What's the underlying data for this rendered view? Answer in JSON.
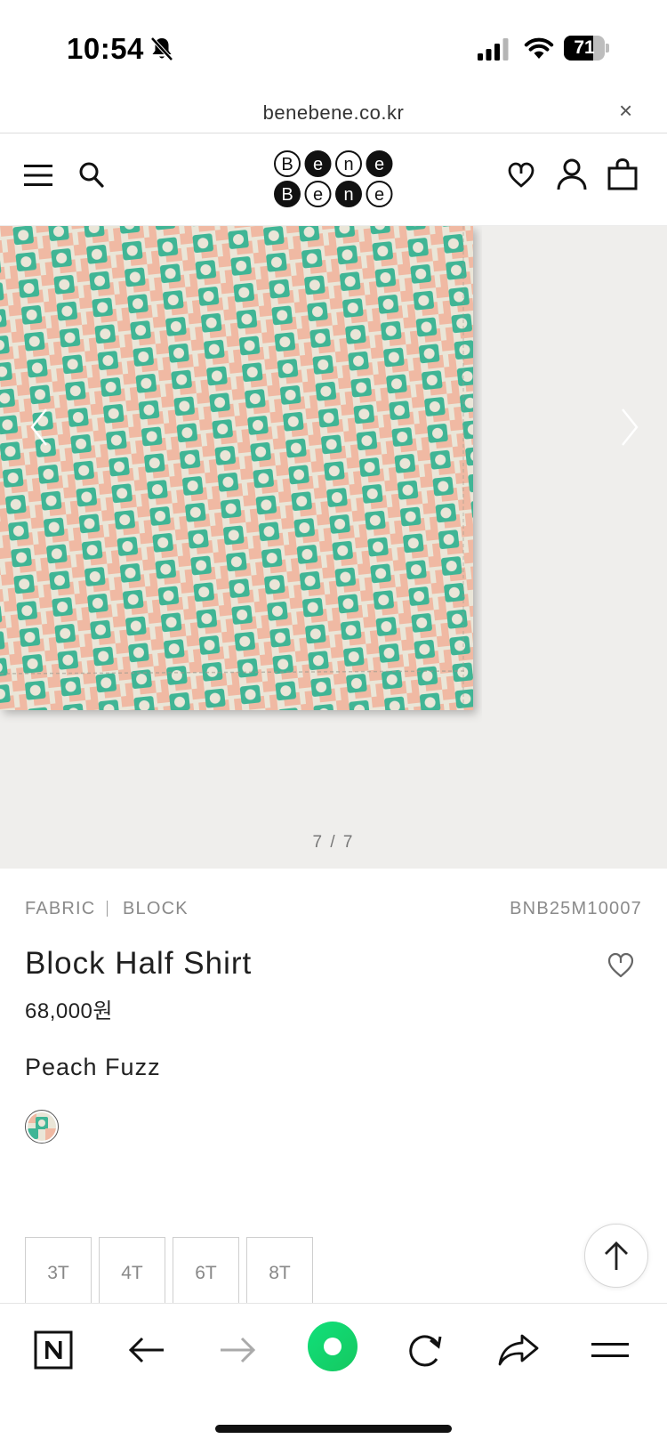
{
  "status_bar": {
    "time": "10:54",
    "battery": "71",
    "battery_level": 0.71
  },
  "url_bar": {
    "domain": "benebene.co.kr",
    "close_label": "×"
  },
  "header": {
    "logo_letters": [
      "B",
      "e",
      "n",
      "e",
      "B",
      "e",
      "n",
      "e"
    ]
  },
  "gallery": {
    "counter": "7 / 7"
  },
  "product": {
    "category": "FABRIC",
    "subcategory": "BLOCK",
    "sku": "BNB25M10007",
    "name": "Block Half Shirt",
    "price": "68,000원",
    "color_name": "Peach Fuzz",
    "sizes": [
      "3T",
      "4T",
      "6T",
      "8T"
    ]
  },
  "colors": {
    "fabric_base": "#eae6d8",
    "fabric_pink": "#f0b9a3",
    "fabric_teal": "#3fb595",
    "gallery_bg": "#efeeec",
    "accent_green": "#19d97a"
  },
  "icons": {
    "menu": "hamburger-icon",
    "search": "search-icon",
    "wishlist": "heart-icon",
    "account": "user-icon",
    "cart": "bag-icon",
    "scroll_top": "arrow-up-icon",
    "toolbar": [
      "naver-n-icon",
      "back-arrow-icon",
      "forward-arrow-icon",
      "green-dot-icon",
      "refresh-icon",
      "share-icon",
      "menu-lines-icon"
    ]
  }
}
